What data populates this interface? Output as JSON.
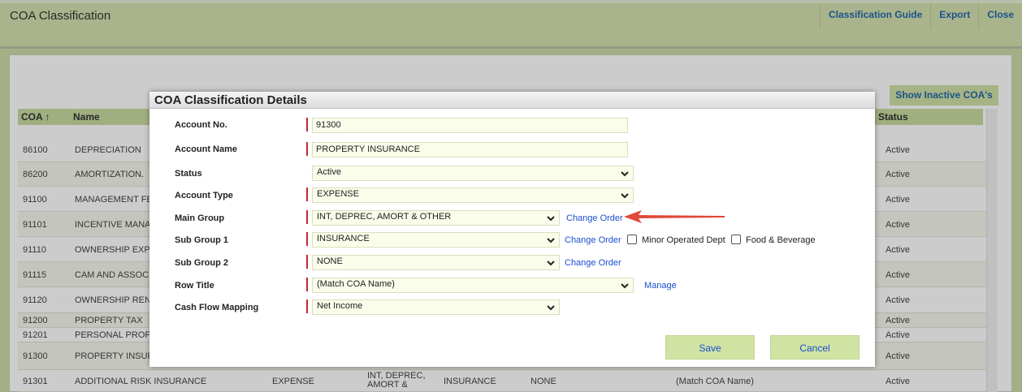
{
  "app": {
    "title": "COA Classification",
    "links": [
      "Classification Guide",
      "Export",
      "Close"
    ]
  },
  "page": {
    "show_inactive_label": "Show Inactive COA's",
    "columns": {
      "coa": "COA ↑",
      "name": "Name",
      "status": "Status"
    },
    "rows": [
      {
        "coa": "86100",
        "name": "DEPRECIATION",
        "status": "Active"
      },
      {
        "coa": "86200",
        "name": "AMORTIZATION.",
        "status": "Active"
      },
      {
        "coa": "91100",
        "name": "MANAGEMENT FEES",
        "status": "Active"
      },
      {
        "coa": "91101",
        "name": "INCENTIVE MANAG",
        "status": "Active"
      },
      {
        "coa": "91110",
        "name": "OWNERSHIP EXPEN",
        "status": "Active"
      },
      {
        "coa": "91115",
        "name": "CAM AND ASSOCIAT",
        "status": "Active"
      },
      {
        "coa": "91120",
        "name": "OWNERSHIP RENTS",
        "status": "Active"
      },
      {
        "coa": "91200",
        "name": "PROPERTY TAX",
        "status": "Active"
      },
      {
        "coa": "91201",
        "name": "PERSONAL PROPER",
        "status": "Active"
      },
      {
        "coa": "91300",
        "name": "PROPERTY INSURA",
        "status": "Active"
      },
      {
        "coa": "91301",
        "name": "ADDITIONAL RISK INSURANCE",
        "type": "EXPENSE",
        "main_group": "INT, DEPREC, AMORT &",
        "sub1": "INSURANCE",
        "sub2": "NONE",
        "row_title": "(Match COA Name)",
        "status": "Active"
      }
    ]
  },
  "modal": {
    "title": "COA Classification Details",
    "labels": {
      "account_no": "Account No.",
      "account_name": "Account Name",
      "status": "Status",
      "account_type": "Account Type",
      "main_group": "Main Group",
      "sub_group_1": "Sub Group 1",
      "sub_group_2": "Sub Group 2",
      "row_title": "Row Title",
      "cash_flow": "Cash Flow Mapping"
    },
    "values": {
      "account_no": "91300",
      "account_name": "PROPERTY INSURANCE",
      "status": "Active",
      "account_type": "EXPENSE",
      "main_group": "INT, DEPREC, AMORT & OTHER",
      "sub_group_1": "INSURANCE",
      "sub_group_2": "NONE",
      "row_title": "(Match COA Name)",
      "cash_flow": "Net Income"
    },
    "links": {
      "change_order": "Change Order",
      "manage": "Manage"
    },
    "checkboxes": {
      "minor_operated": "Minor Operated Dept",
      "food_beverage": "Food & Beverage"
    },
    "buttons": {
      "save": "Save",
      "cancel": "Cancel"
    },
    "colors": {
      "required_marker": "#c3282e",
      "annotation_arrow": "#e0483a"
    }
  }
}
